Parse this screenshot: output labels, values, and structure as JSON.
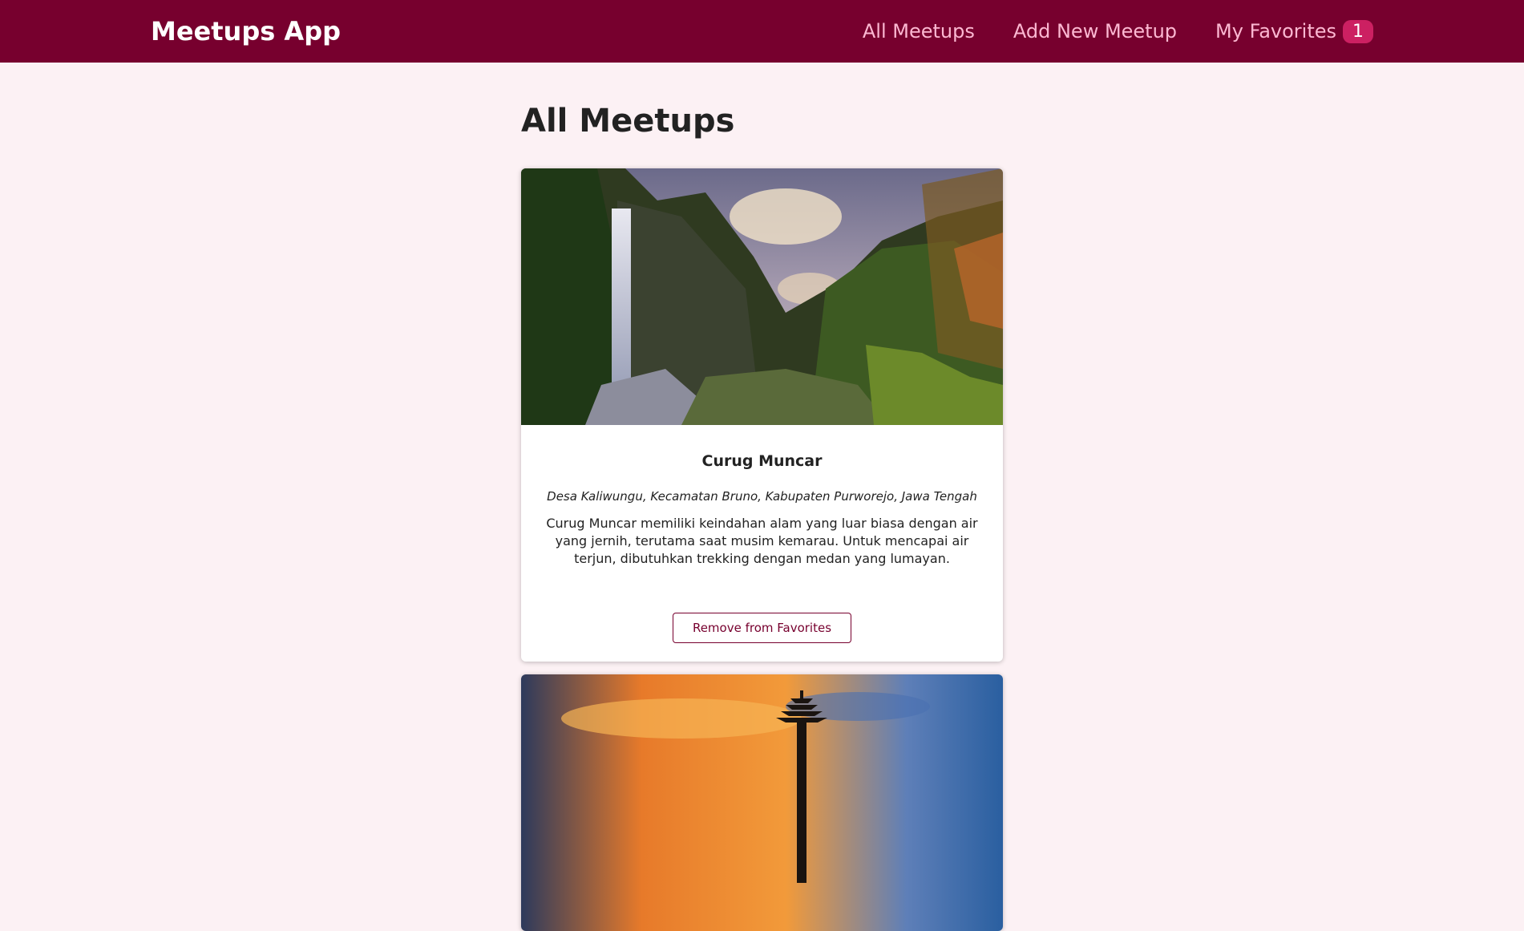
{
  "header": {
    "logo": "Meetups App",
    "nav": [
      {
        "label": "All Meetups"
      },
      {
        "label": "Add New Meetup"
      },
      {
        "label": "My Favorites",
        "badge": "1"
      }
    ]
  },
  "main": {
    "title": "All Meetups",
    "meetups": [
      {
        "title": "Curug Muncar",
        "address": "Desa Kaliwungu, Kecamatan Bruno, Kabupaten Purworejo, Jawa Tengah",
        "description": "Curug Muncar memiliki keindahan alam yang luar biasa dengan air yang jernih, terutama saat musim kemarau. Untuk mencapai air terjun, dibutuhkan trekking dengan medan yang lumayan.",
        "button": "Remove from Favorites"
      }
    ]
  },
  "colors": {
    "header_bg": "#77002e",
    "page_bg": "#fcf1f4",
    "nav_link": "#fcb8d2",
    "badge_bg": "#cc2062",
    "accent": "#77002e"
  }
}
